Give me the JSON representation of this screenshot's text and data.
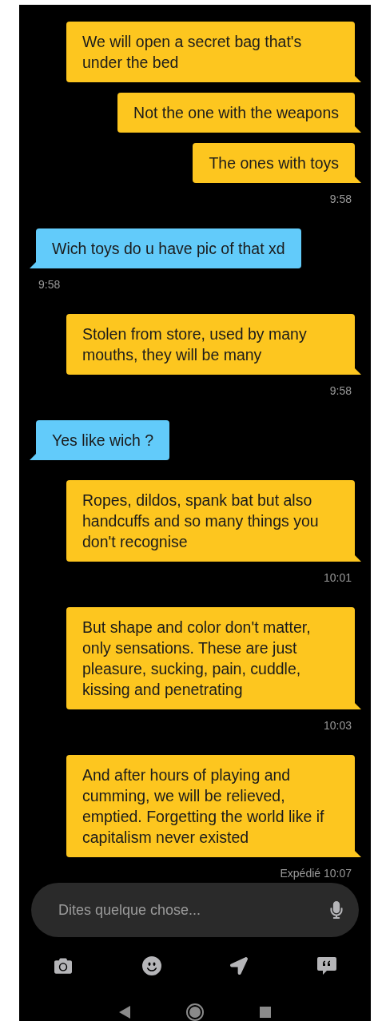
{
  "groups": [
    {
      "kind": "sent",
      "messages": [
        "We will open a secret bag that's under the bed",
        "Not the one with the weapons",
        "The ones with toys"
      ],
      "time": "9:58"
    },
    {
      "kind": "received",
      "messages": [
        "Wich toys do u have pic of that xd"
      ],
      "time": "9:58"
    },
    {
      "kind": "sent",
      "messages": [
        "Stolen from store, used by many mouths, they will be many"
      ],
      "time": "9:58"
    },
    {
      "kind": "received",
      "messages": [
        "Yes like wich ?"
      ]
    },
    {
      "kind": "sent",
      "messages": [
        "Ropes, dildos, spank bat but also handcuffs and so many things you don't recognise"
      ],
      "time": "10:01"
    },
    {
      "kind": "sent",
      "messages": [
        "But shape and color don't matter, only sensations. These are just pleasure, sucking, pain, cuddle, kissing and penetrating"
      ],
      "time": "10:03"
    },
    {
      "kind": "sent",
      "messages": [
        "And after hours of playing and cumming, we will be relieved, emptied. Forgetting the world like if capitalism never existed"
      ],
      "time": "Expédié 10:07"
    }
  ],
  "composer": {
    "placeholder": "Dites quelque chose..."
  }
}
